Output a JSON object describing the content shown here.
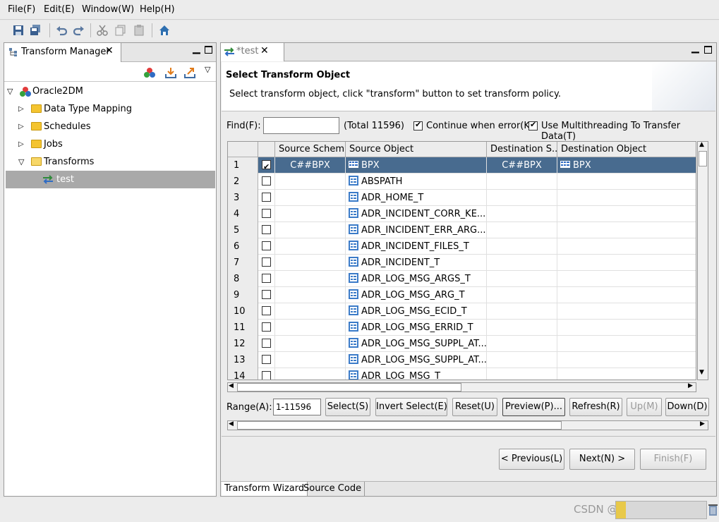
{
  "menu": [
    "File(F)",
    "Edit(E)",
    "Window(W)",
    "Help(H)"
  ],
  "left_panel": {
    "tab_label": "Transform Manager",
    "tree": {
      "root": "Oracle2DM",
      "items": [
        "Data Type Mapping",
        "Schedules",
        "Jobs",
        "Transforms"
      ],
      "transform_child": "test"
    }
  },
  "editor": {
    "tab_label": "*test",
    "header_title": "Select Transform Object",
    "header_desc": "Select transform object, click \"transform\" button to set transform policy.",
    "find_label": "Find(F):",
    "find_value": "",
    "total": "(Total 11596)",
    "continue_label": "Continue when error(K)",
    "multithread_label": "Use Multithreading To Transfer Data(T)",
    "columns": [
      "Source Schem...",
      "Source Object",
      "Destination S...",
      "Destination Object"
    ],
    "rows": [
      {
        "num": "1",
        "checked": true,
        "src_schema": "C##BPX",
        "src_obj": "BPX",
        "dst_schema": "C##BPX",
        "dst_obj": "BPX",
        "selected": true
      },
      {
        "num": "2",
        "checked": false,
        "src_schema": "",
        "src_obj": "ABSPATH",
        "dst_schema": "",
        "dst_obj": ""
      },
      {
        "num": "3",
        "checked": false,
        "src_schema": "",
        "src_obj": "ADR_HOME_T",
        "dst_schema": "",
        "dst_obj": ""
      },
      {
        "num": "4",
        "checked": false,
        "src_schema": "",
        "src_obj": "ADR_INCIDENT_CORR_KE...",
        "dst_schema": "",
        "dst_obj": ""
      },
      {
        "num": "5",
        "checked": false,
        "src_schema": "",
        "src_obj": "ADR_INCIDENT_ERR_ARG...",
        "dst_schema": "",
        "dst_obj": ""
      },
      {
        "num": "6",
        "checked": false,
        "src_schema": "",
        "src_obj": "ADR_INCIDENT_FILES_T",
        "dst_schema": "",
        "dst_obj": ""
      },
      {
        "num": "7",
        "checked": false,
        "src_schema": "",
        "src_obj": "ADR_INCIDENT_T",
        "dst_schema": "",
        "dst_obj": ""
      },
      {
        "num": "8",
        "checked": false,
        "src_schema": "",
        "src_obj": "ADR_LOG_MSG_ARGS_T",
        "dst_schema": "",
        "dst_obj": ""
      },
      {
        "num": "9",
        "checked": false,
        "src_schema": "",
        "src_obj": "ADR_LOG_MSG_ARG_T",
        "dst_schema": "",
        "dst_obj": ""
      },
      {
        "num": "10",
        "checked": false,
        "src_schema": "",
        "src_obj": "ADR_LOG_MSG_ECID_T",
        "dst_schema": "",
        "dst_obj": ""
      },
      {
        "num": "11",
        "checked": false,
        "src_schema": "",
        "src_obj": "ADR_LOG_MSG_ERRID_T",
        "dst_schema": "",
        "dst_obj": ""
      },
      {
        "num": "12",
        "checked": false,
        "src_schema": "",
        "src_obj": "ADR_LOG_MSG_SUPPL_AT...",
        "dst_schema": "",
        "dst_obj": ""
      },
      {
        "num": "13",
        "checked": false,
        "src_schema": "",
        "src_obj": "ADR_LOG_MSG_SUPPL_AT...",
        "dst_schema": "",
        "dst_obj": ""
      },
      {
        "num": "14",
        "checked": false,
        "src_schema": "",
        "src_obj": "ADR_LOG_MSG_T",
        "dst_schema": "",
        "dst_obj": ""
      }
    ],
    "range_label": "Range(A):",
    "range_value": "1-11596",
    "buttons": {
      "select": "Select(S)",
      "invert": "Invert Select(E)",
      "reset": "Reset(U)",
      "preview": "Preview(P)...",
      "refresh": "Refresh(R)",
      "up": "Up(M)",
      "down": "Down(D)"
    },
    "nav": {
      "previous": "< Previous(L)",
      "next": "Next(N) >",
      "finish": "Finish(F)"
    },
    "bottom_tabs": [
      "Transform Wizard",
      "Source Code"
    ]
  },
  "status": {
    "watermark": "CSDN @"
  }
}
